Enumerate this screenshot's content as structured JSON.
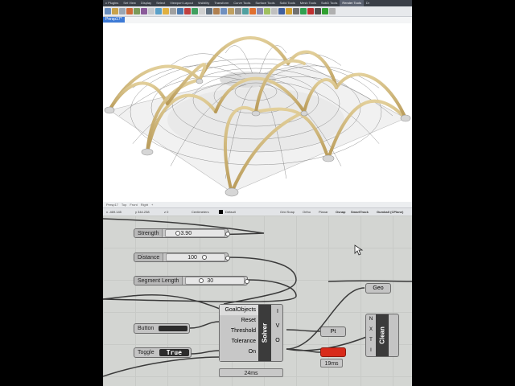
{
  "tabs": [
    "c Plugins",
    "Set View",
    "Display",
    "Select",
    "Viewport Layout",
    "Visibility",
    "Transform",
    "Curve Tools",
    "Surface Tools",
    "Solid Tools",
    "Mesh Tools",
    "SubD Tools",
    "Render Tools",
    "Dr"
  ],
  "viewport": {
    "active_tab": "Persp17*",
    "bottom_tabs": [
      "Persp17",
      "Top",
      "Front",
      "Right",
      "+"
    ]
  },
  "status": {
    "coords": "x -469.145",
    "y": "y 344.238",
    "z": "z 0",
    "units": "Centimeters",
    "layer": "Default",
    "grid_snap": "Grid Snap",
    "ortho": "Ortho",
    "planar": "Planar",
    "osnap": "Osnap",
    "smarttrack": "SmartTrack",
    "gumball": "Gumball (CPlane)"
  },
  "gh": {
    "strength": {
      "label": "Strength",
      "value": "3.90"
    },
    "distance": {
      "label": "Distance",
      "value": "100"
    },
    "segment": {
      "label": "Segment Length",
      "value": "30"
    },
    "button": {
      "label": "Button"
    },
    "toggle": {
      "label": "Toggle",
      "value": "True"
    },
    "solver": {
      "name": "Solver",
      "inputs": [
        "GoalObjects",
        "Reset",
        "Threshold",
        "Tolerance",
        "On"
      ],
      "outputs": [
        "I",
        "V",
        "O"
      ]
    },
    "solver_time": "24ms",
    "geo": "Geo",
    "pt": "Pt",
    "clean": {
      "name": "Clean",
      "inputs": [
        "N",
        "X",
        "T",
        "I"
      ]
    },
    "red_time": "19ms"
  }
}
